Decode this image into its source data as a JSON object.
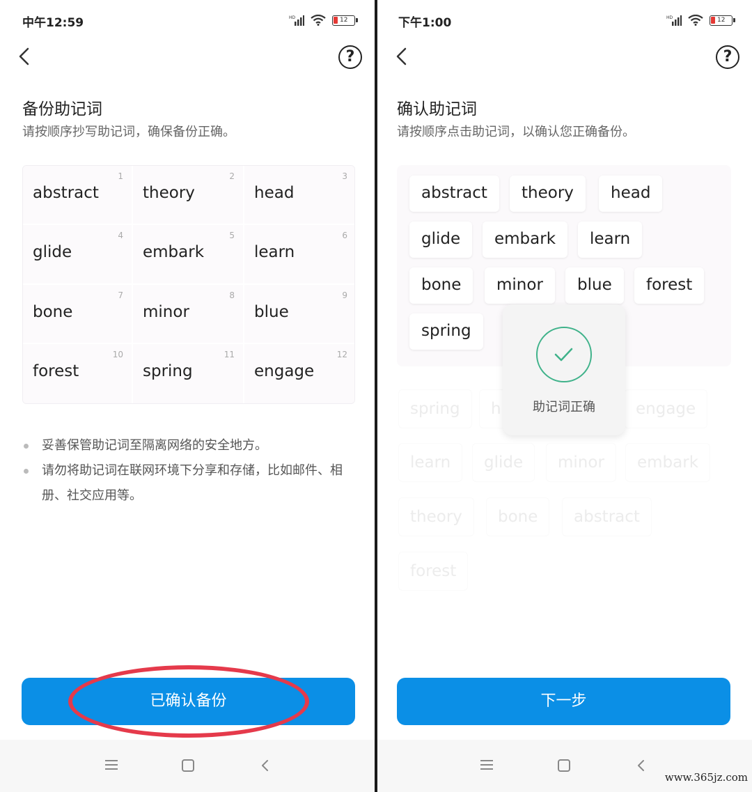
{
  "screen1": {
    "status_time": "中午12:59",
    "battery_level": "12",
    "title": "备份助记词",
    "subtitle": "请按顺序抄写助记词，确保备份正确。",
    "words": [
      {
        "index": "1",
        "word": "abstract"
      },
      {
        "index": "2",
        "word": "theory"
      },
      {
        "index": "3",
        "word": "head"
      },
      {
        "index": "4",
        "word": "glide"
      },
      {
        "index": "5",
        "word": "embark"
      },
      {
        "index": "6",
        "word": "learn"
      },
      {
        "index": "7",
        "word": "bone"
      },
      {
        "index": "8",
        "word": "minor"
      },
      {
        "index": "9",
        "word": "blue"
      },
      {
        "index": "10",
        "word": "forest"
      },
      {
        "index": "11",
        "word": "spring"
      },
      {
        "index": "12",
        "word": "engage"
      }
    ],
    "notes": [
      "妥善保管助记词至隔离网络的安全地方。",
      "请勿将助记词在联网环境下分享和存储，比如邮件、相册、社交应用等。"
    ],
    "button_label": "已确认备份",
    "annotation_color": "#e53a4b"
  },
  "screen2": {
    "status_time": "下午1:00",
    "battery_level": "12",
    "title": "确认助记词",
    "subtitle": "请按顺序点击助记词，以确认您正确备份。",
    "selected_words": [
      "abstract",
      "theory",
      "head",
      "glide",
      "embark",
      "learn",
      "bone",
      "minor",
      "blue",
      "forest",
      "spring"
    ],
    "candidate_words": [
      "spring",
      "h",
      "engage",
      "learn",
      "glide",
      "minor",
      "embark",
      "theory",
      "bone",
      "abstract",
      "forest"
    ],
    "toast_text": "助记词正确",
    "button_label": "下一步",
    "toast_check_color": "#3fb28a"
  },
  "theme": {
    "primary": "#0b8fe6"
  },
  "watermark": "www.365jz.com"
}
